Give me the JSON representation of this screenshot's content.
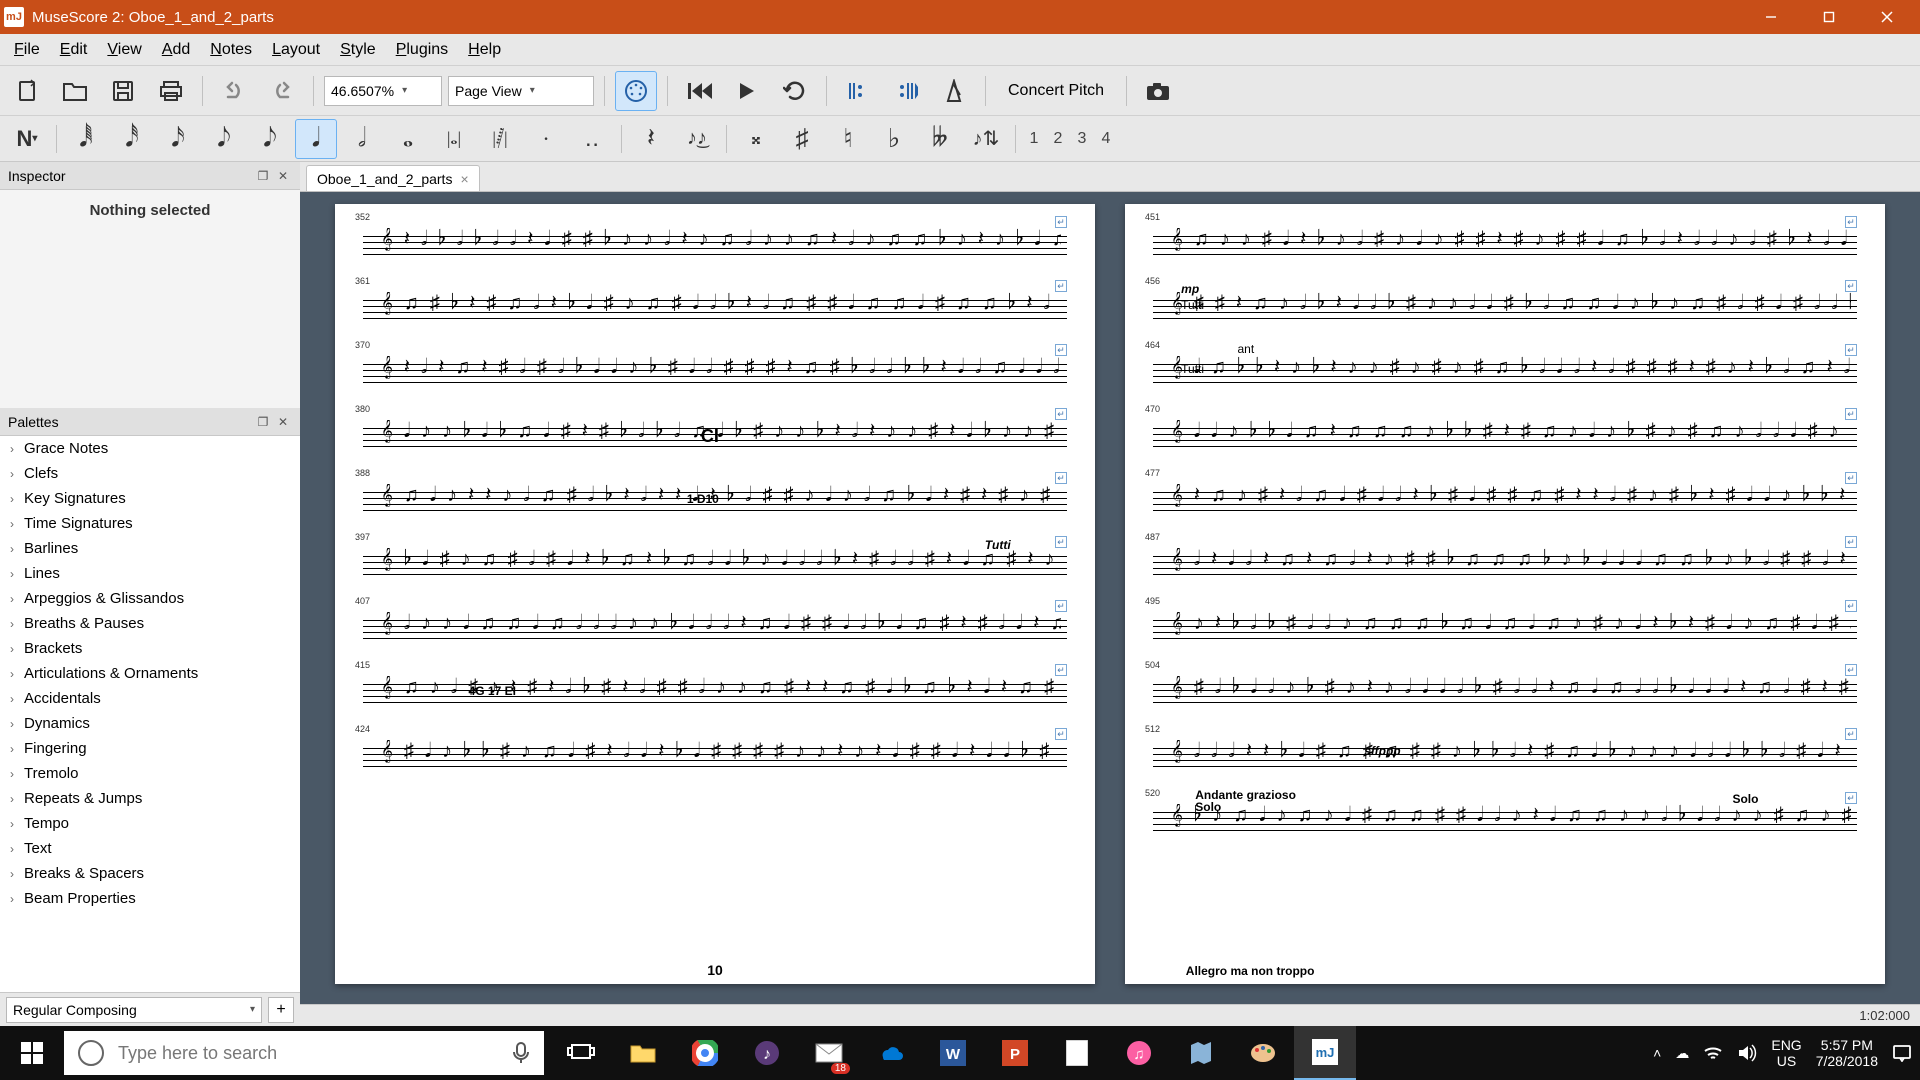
{
  "titlebar": {
    "app": "MuseScore 2",
    "doc": "Oboe_1_and_2_parts"
  },
  "menus": [
    "File",
    "Edit",
    "View",
    "Add",
    "Notes",
    "Layout",
    "Style",
    "Plugins",
    "Help"
  ],
  "toolbar": {
    "zoom": "46.6507%",
    "view": "Page View",
    "concert_pitch": "Concert Pitch"
  },
  "voices": [
    "1",
    "2",
    "3",
    "4"
  ],
  "inspector": {
    "title": "Inspector",
    "body": "Nothing selected"
  },
  "palettes": {
    "title": "Palettes",
    "items": [
      "Grace Notes",
      "Clefs",
      "Key Signatures",
      "Time Signatures",
      "Barlines",
      "Lines",
      "Arpeggios & Glissandos",
      "Breaths & Pauses",
      "Brackets",
      "Articulations & Ornaments",
      "Accidentals",
      "Dynamics",
      "Fingering",
      "Tremolo",
      "Repeats & Jumps",
      "Tempo",
      "Text",
      "Breaks & Spacers",
      "Beam Properties"
    ],
    "workspace": "Regular Composing"
  },
  "tab": {
    "label": "Oboe_1_and_2_parts"
  },
  "score": {
    "left_page_number": "10",
    "left_measures": [
      "352",
      "361",
      "370",
      "380",
      "388",
      "397",
      "407",
      "415",
      "424"
    ],
    "left_annotations": {
      "CI": "CI",
      "D10": "1 D10",
      "rehearsal": "4G 17 EI",
      "tutti": "Tutti"
    },
    "right_measures": [
      "451",
      "456",
      "464",
      "470",
      "477",
      "487",
      "495",
      "504",
      "512",
      "520"
    ],
    "right_annotations": {
      "mp": "mp",
      "tutti1": "Tutti",
      "ant": "ant",
      "tutti2": "Tutti",
      "andante": "Andante grazioso",
      "solo": "Solo",
      "solo2": "Solo",
      "allegro": "Allegro ma non troppo",
      "sffppp": "sffppp"
    }
  },
  "status": {
    "time": "1:02:000"
  },
  "taskbar": {
    "search_placeholder": "Type here to search",
    "mail_badge": "18",
    "lang1": "ENG",
    "lang2": "US",
    "clock": "5:57 PM",
    "date": "7/28/2018"
  }
}
